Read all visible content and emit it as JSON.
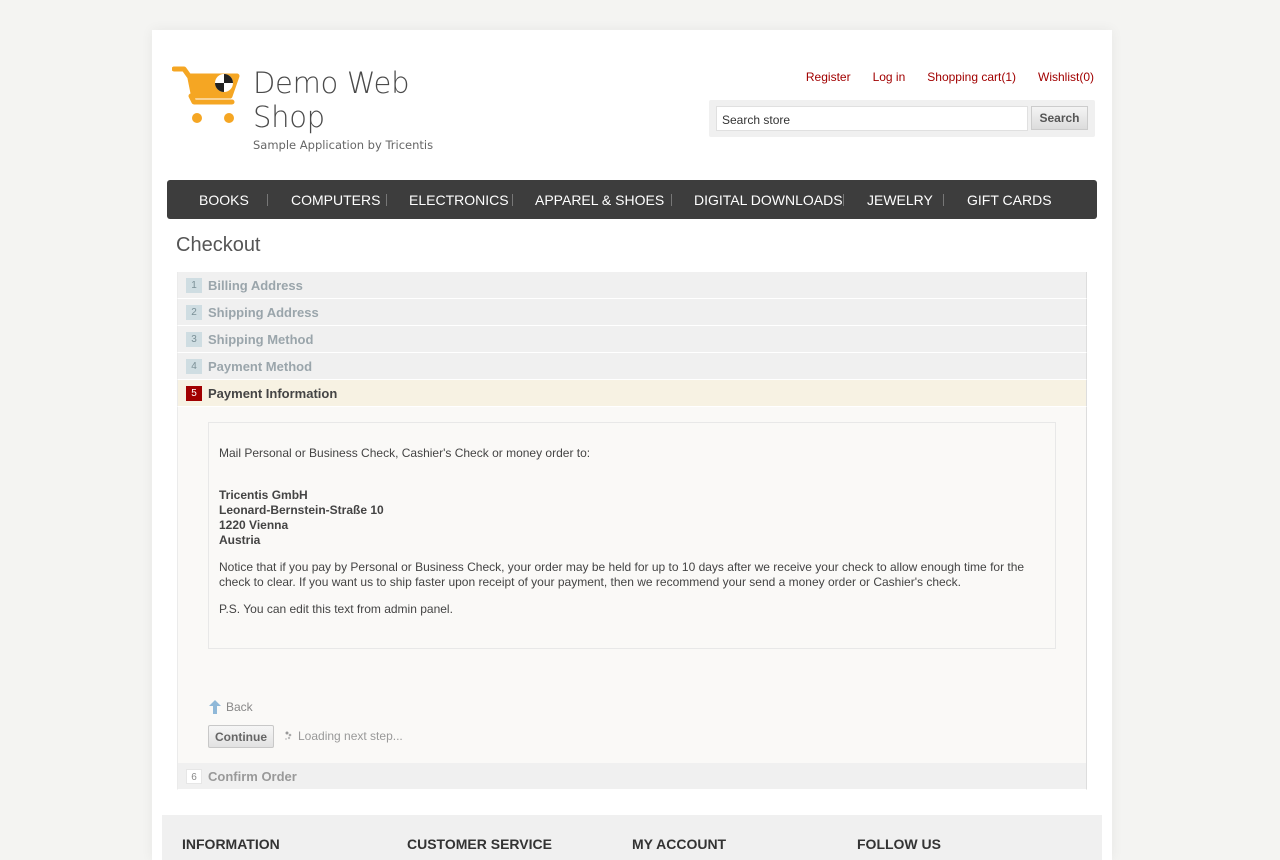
{
  "header": {
    "logo_title": "Demo Web Shop",
    "logo_subtitle": "Sample Application by Tricentis",
    "links": {
      "register": "Register",
      "login": "Log in",
      "cart": "Shopping cart(1)",
      "wishlist": "Wishlist(0)"
    },
    "search": {
      "value": "Search store",
      "button": "Search"
    }
  },
  "nav": [
    "BOOKS",
    "COMPUTERS",
    "ELECTRONICS",
    "APPAREL & SHOES",
    "DIGITAL DOWNLOADS",
    "JEWELRY",
    "GIFT CARDS"
  ],
  "page_title": "Checkout",
  "steps": [
    {
      "num": "1",
      "label": "Billing Address"
    },
    {
      "num": "2",
      "label": "Shipping Address"
    },
    {
      "num": "3",
      "label": "Shipping Method"
    },
    {
      "num": "4",
      "label": "Payment Method"
    },
    {
      "num": "5",
      "label": "Payment Information"
    },
    {
      "num": "6",
      "label": "Confirm Order"
    }
  ],
  "payment_info": {
    "intro": "Mail Personal or Business Check, Cashier's Check or money order to:",
    "address": [
      "Tricentis GmbH",
      "Leonard-Bernstein-Straße 10",
      "1220 Vienna",
      "Austria"
    ],
    "notice": "Notice that if you pay by Personal or Business Check, your order may be held for up to 10 days after we receive your check to allow enough time for the check to clear. If you want us to ship faster upon receipt of your payment, then we recommend your send a money order or Cashier's check.",
    "ps": "P.S. You can edit this text from admin panel."
  },
  "actions": {
    "back": "Back",
    "continue": "Continue",
    "loading": "Loading next step..."
  },
  "footer": [
    "INFORMATION",
    "CUSTOMER SERVICE",
    "MY ACCOUNT",
    "FOLLOW US"
  ],
  "colors": {
    "accent": "#a10000",
    "nav_bg": "#3d3d3d",
    "active_step_bg": "#f7f2e3",
    "logo_cart": "#f5a623"
  }
}
